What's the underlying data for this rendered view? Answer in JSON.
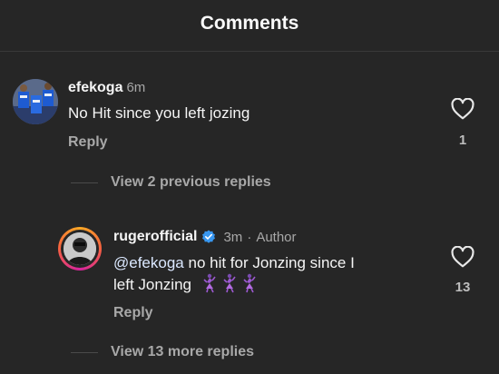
{
  "header": {
    "title": "Comments"
  },
  "comments": [
    {
      "username": "efekoga",
      "time": "6m",
      "text": "No Hit since you left jozing",
      "reply_label": "Reply",
      "like_count": "1"
    }
  ],
  "view_previous": "View 2 previous replies",
  "reply": {
    "username": "rugerofficial",
    "verified": true,
    "time": "3m",
    "separator": "·",
    "author_label": "Author",
    "mention": "@efekoga",
    "text_line1": " no hit for Jonzing since I",
    "text_line2": "left Jonzing",
    "emojis": [
      "dancing-woman-emoji",
      "dancing-woman-emoji",
      "dancing-woman-emoji"
    ],
    "reply_label": "Reply",
    "like_count": "13"
  },
  "view_more": "View 13 more replies",
  "colors": {
    "background": "#262626",
    "verified_blue": "#3897f0",
    "story_ring_start": "#f9a825",
    "story_ring_end": "#d6249f"
  }
}
